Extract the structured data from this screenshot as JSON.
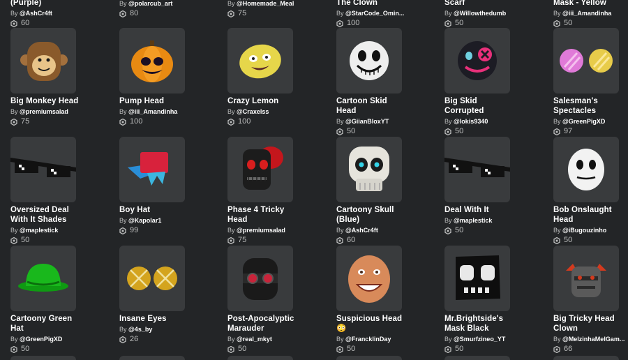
{
  "top_row": [
    {
      "name": "(Purple)",
      "creator": "@AshCr4ft",
      "price": "60"
    },
    {
      "name": "",
      "creator": "@polarcub_art",
      "price": "80"
    },
    {
      "name": "",
      "creator": "@Homemade_Meal",
      "price": "75"
    },
    {
      "name": "The Clown",
      "creator": "@StarCode_Omin...",
      "price": "100"
    },
    {
      "name": "Scarf",
      "creator": "@Willowthedumb",
      "price": "50"
    },
    {
      "name": "Mask - Yellow",
      "creator": "@iii_Amandinha",
      "price": "50"
    }
  ],
  "rows": [
    [
      {
        "name": "Big Monkey Head",
        "creator": "@premiumsalad",
        "price": "75",
        "icon": "monkey-head-icon"
      },
      {
        "name": "Pump Head",
        "creator": "@iii_Amandinha",
        "price": "100",
        "icon": "pumpkin-head-icon"
      },
      {
        "name": "Crazy Lemon",
        "creator": "@Craxelss",
        "price": "100",
        "icon": "lemon-head-icon"
      },
      {
        "name": "Cartoon Skid\nHead",
        "creator": "@GiianBloxYT",
        "price": "50",
        "icon": "skid-head-icon"
      },
      {
        "name": "Big Skid\nCorrupted",
        "creator": "@lokis9340",
        "price": "50",
        "icon": "corrupted-skid-icon"
      },
      {
        "name": "Salesman's\nSpectacles",
        "creator": "@GreenPigXD",
        "price": "97",
        "icon": "spectacles-icon"
      }
    ],
    [
      {
        "name": "Oversized Deal\nWith It Shades",
        "creator": "@maplestick",
        "price": "50",
        "icon": "pixel-shades-icon"
      },
      {
        "name": "Boy Hat",
        "creator": "@Kapolar1",
        "price": "99",
        "icon": "boy-hat-icon"
      },
      {
        "name": "Phase 4 Tricky\nHead",
        "creator": "@premiumsalad",
        "price": "75",
        "icon": "tricky-head-icon"
      },
      {
        "name": "Cartoony Skull\n(Blue)",
        "creator": "@AshCr4ft",
        "price": "60",
        "icon": "skull-icon"
      },
      {
        "name": "Deal With It",
        "creator": "@maplestick",
        "price": "50",
        "icon": "pixel-shades-icon"
      },
      {
        "name": "Bob Onslaught\nHead",
        "creator": "@iBugouzinho",
        "price": "50",
        "icon": "bob-head-icon"
      }
    ],
    [
      {
        "name": "Cartoony Green\nHat",
        "creator": "@GreenPigXD",
        "price": "50",
        "icon": "green-bowler-hat-icon"
      },
      {
        "name": "Insane Eyes",
        "creator": "@4s_by",
        "price": "26",
        "icon": "insane-eyes-icon"
      },
      {
        "name": "Post-Apocalyptic\nMarauder",
        "creator": "@real_mkyt",
        "price": "50",
        "icon": "marauder-mask-icon"
      },
      {
        "name": "Suspicious Head\n😳",
        "creator": "@FrancklinDay",
        "price": "50",
        "icon": "suspicious-head-icon"
      },
      {
        "name": "Mr.Brightside's\nMask Black",
        "creator": "@Smurfzineo_YT",
        "price": "50",
        "icon": "brightside-mask-icon"
      },
      {
        "name": "Big Tricky Head\nClown",
        "creator": "@MelzinhaMelGam...",
        "price": "66",
        "icon": "tricky-clown-icon"
      }
    ]
  ],
  "by_label": "By",
  "currency_icon": "robux-icon",
  "colors": {
    "background": "#232527",
    "thumb": "#393b3d",
    "text": "#ffffff",
    "muted": "#bdbebe"
  }
}
